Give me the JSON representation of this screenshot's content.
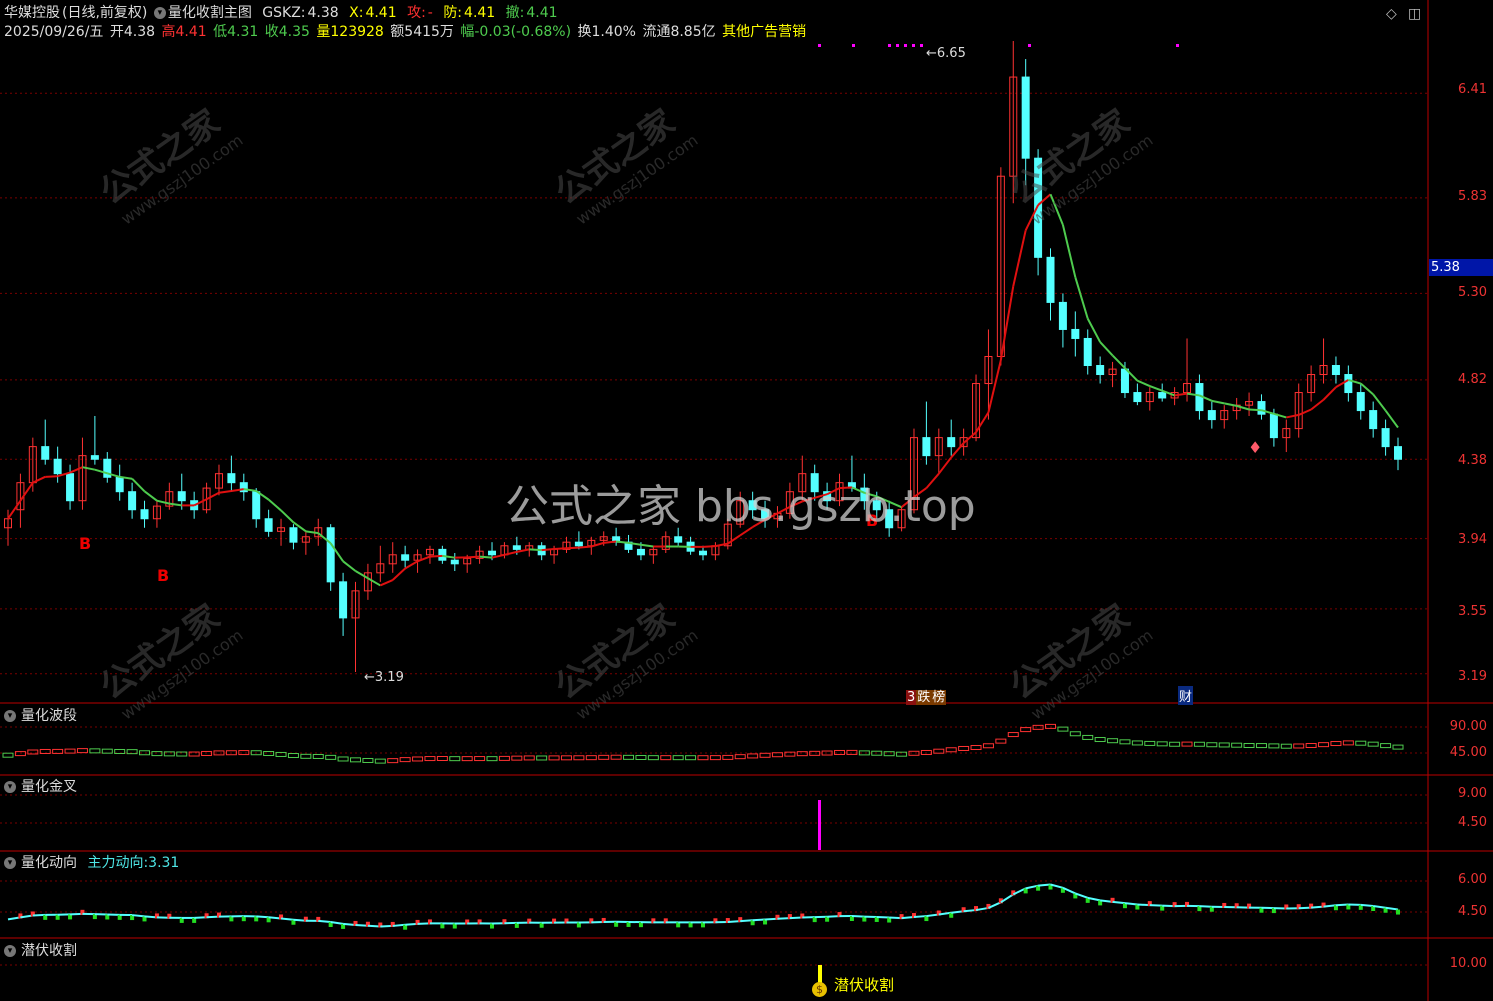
{
  "header": {
    "stock_name": "华媒控股",
    "period_label": "(日线,前复权)",
    "indicator_name": "量化收割主图",
    "gskz_label": "GSKZ:",
    "gskz_value": "4.38",
    "x_label": "X:",
    "x_value": "4.41",
    "gong_label": "攻:",
    "gong_value": "-",
    "fang_label": "防:",
    "fang_value": "4.41",
    "che_label": "撤:",
    "che_value": "4.41"
  },
  "quote": {
    "date": "2025/09/26/五",
    "open": "开4.38",
    "high": "高4.41",
    "low": "低4.31",
    "close": "收4.35",
    "volume": "量123928",
    "amount": "额5415万",
    "change": "幅-0.03(-0.68%)",
    "turnover": "换1.40%",
    "float": "流通8.85亿",
    "sector": "其他广告营销"
  },
  "price_axis": [
    "6.41",
    "5.83",
    "5.30",
    "4.82",
    "4.38",
    "3.94",
    "3.55",
    "3.19"
  ],
  "current_price_tag": "5.38",
  "annotations": {
    "high_mark": "6.65",
    "low_mark": "3.19",
    "buy_marks": [
      "B",
      "B",
      "B"
    ],
    "event_tags": [
      "3",
      "跌",
      "榜",
      "财"
    ]
  },
  "panels": {
    "wave": {
      "title": "量化波段",
      "axis": [
        "90.00",
        "45.00"
      ]
    },
    "golden_cross": {
      "title": "量化金叉",
      "axis": [
        "9.00",
        "4.50"
      ]
    },
    "direction": {
      "title": "量化动向",
      "sub_label": "主力动向:",
      "sub_value": "3.31",
      "axis": [
        "6.00",
        "4.50"
      ]
    },
    "harvest": {
      "title": "潜伏收割",
      "axis": [
        "10.00"
      ],
      "signal_label": "潜伏收割"
    }
  },
  "watermark": {
    "cn": "公式之家",
    "url": "www.gszj100.com",
    "center": "公式之家 bbs.gszb.top"
  },
  "colors": {
    "up": "#ff3232",
    "down": "#54ffff",
    "ma_up": "#e01010",
    "ma_down": "#4ecb4e",
    "grid": "#7a0000",
    "magenta": "#ff00ff",
    "yellow": "#ffff00"
  },
  "chart_data": {
    "type": "candlestick",
    "ylim": [
      3.1,
      6.75
    ],
    "candles": [
      [
        4.0,
        4.1,
        3.9,
        4.05
      ],
      [
        4.1,
        4.3,
        4.0,
        4.25
      ],
      [
        4.25,
        4.5,
        4.2,
        4.45
      ],
      [
        4.45,
        4.6,
        4.35,
        4.38
      ],
      [
        4.38,
        4.45,
        4.25,
        4.3
      ],
      [
        4.3,
        4.35,
        4.1,
        4.15
      ],
      [
        4.15,
        4.5,
        4.1,
        4.4
      ],
      [
        4.4,
        4.62,
        4.35,
        4.38
      ],
      [
        4.38,
        4.42,
        4.25,
        4.28
      ],
      [
        4.28,
        4.35,
        4.15,
        4.2
      ],
      [
        4.2,
        4.25,
        4.05,
        4.1
      ],
      [
        4.1,
        4.15,
        4.0,
        4.05
      ],
      [
        4.05,
        4.15,
        4.0,
        4.12
      ],
      [
        4.12,
        4.25,
        4.1,
        4.2
      ],
      [
        4.2,
        4.3,
        4.1,
        4.15
      ],
      [
        4.15,
        4.2,
        4.05,
        4.1
      ],
      [
        4.1,
        4.25,
        4.08,
        4.22
      ],
      [
        4.22,
        4.35,
        4.18,
        4.3
      ],
      [
        4.3,
        4.4,
        4.2,
        4.25
      ],
      [
        4.25,
        4.3,
        4.15,
        4.2
      ],
      [
        4.2,
        4.22,
        4.0,
        4.05
      ],
      [
        4.05,
        4.1,
        3.95,
        3.98
      ],
      [
        3.98,
        4.05,
        3.9,
        4.0
      ],
      [
        4.0,
        4.02,
        3.88,
        3.92
      ],
      [
        3.92,
        3.98,
        3.85,
        3.95
      ],
      [
        3.95,
        4.05,
        3.9,
        4.0
      ],
      [
        4.0,
        4.02,
        3.65,
        3.7
      ],
      [
        3.7,
        3.75,
        3.4,
        3.5
      ],
      [
        3.5,
        3.7,
        3.2,
        3.65
      ],
      [
        3.65,
        3.8,
        3.6,
        3.75
      ],
      [
        3.75,
        3.9,
        3.7,
        3.8
      ],
      [
        3.8,
        3.92,
        3.75,
        3.85
      ],
      [
        3.85,
        3.9,
        3.78,
        3.82
      ],
      [
        3.82,
        3.88,
        3.75,
        3.85
      ],
      [
        3.85,
        3.9,
        3.8,
        3.88
      ],
      [
        3.88,
        3.9,
        3.8,
        3.82
      ],
      [
        3.82,
        3.86,
        3.76,
        3.8
      ],
      [
        3.8,
        3.85,
        3.75,
        3.83
      ],
      [
        3.83,
        3.9,
        3.8,
        3.87
      ],
      [
        3.87,
        3.92,
        3.82,
        3.85
      ],
      [
        3.85,
        3.92,
        3.83,
        3.9
      ],
      [
        3.9,
        3.95,
        3.85,
        3.88
      ],
      [
        3.88,
        3.92,
        3.84,
        3.9
      ],
      [
        3.9,
        3.92,
        3.82,
        3.85
      ],
      [
        3.85,
        3.9,
        3.8,
        3.88
      ],
      [
        3.88,
        3.95,
        3.86,
        3.92
      ],
      [
        3.92,
        3.98,
        3.88,
        3.9
      ],
      [
        3.9,
        3.95,
        3.85,
        3.93
      ],
      [
        3.93,
        3.98,
        3.9,
        3.95
      ],
      [
        3.95,
        4.0,
        3.9,
        3.92
      ],
      [
        3.92,
        3.96,
        3.86,
        3.88
      ],
      [
        3.88,
        3.92,
        3.82,
        3.85
      ],
      [
        3.85,
        3.9,
        3.8,
        3.88
      ],
      [
        3.88,
        3.98,
        3.86,
        3.95
      ],
      [
        3.95,
        4.0,
        3.9,
        3.92
      ],
      [
        3.92,
        3.95,
        3.85,
        3.87
      ],
      [
        3.87,
        3.9,
        3.82,
        3.85
      ],
      [
        3.85,
        3.92,
        3.82,
        3.9
      ],
      [
        3.9,
        4.05,
        3.88,
        4.02
      ],
      [
        4.02,
        4.2,
        4.0,
        4.15
      ],
      [
        4.15,
        4.2,
        4.05,
        4.1
      ],
      [
        4.1,
        4.15,
        4.0,
        4.05
      ],
      [
        4.05,
        4.12,
        4.0,
        4.08
      ],
      [
        4.08,
        4.25,
        4.05,
        4.2
      ],
      [
        4.2,
        4.4,
        4.15,
        4.3
      ],
      [
        4.3,
        4.35,
        4.15,
        4.2
      ],
      [
        4.2,
        4.25,
        4.1,
        4.15
      ],
      [
        4.15,
        4.3,
        4.12,
        4.25
      ],
      [
        4.25,
        4.4,
        4.2,
        4.22
      ],
      [
        4.22,
        4.3,
        4.1,
        4.15
      ],
      [
        4.15,
        4.2,
        4.05,
        4.1
      ],
      [
        4.1,
        4.15,
        3.95,
        4.0
      ],
      [
        4.0,
        4.12,
        3.98,
        4.1
      ],
      [
        4.1,
        4.55,
        4.08,
        4.5
      ],
      [
        4.5,
        4.7,
        4.35,
        4.4
      ],
      [
        4.4,
        4.55,
        4.3,
        4.5
      ],
      [
        4.5,
        4.6,
        4.4,
        4.45
      ],
      [
        4.45,
        4.55,
        4.4,
        4.5
      ],
      [
        4.5,
        4.85,
        4.48,
        4.8
      ],
      [
        4.8,
        5.1,
        4.6,
        4.95
      ],
      [
        4.95,
        6.0,
        4.9,
        5.95
      ],
      [
        5.95,
        6.7,
        5.8,
        6.5
      ],
      [
        6.5,
        6.6,
        5.9,
        6.05
      ],
      [
        6.05,
        6.1,
        5.4,
        5.5
      ],
      [
        5.5,
        5.55,
        5.15,
        5.25
      ],
      [
        5.25,
        5.3,
        5.0,
        5.1
      ],
      [
        5.1,
        5.2,
        4.95,
        5.05
      ],
      [
        5.05,
        5.1,
        4.85,
        4.9
      ],
      [
        4.9,
        4.95,
        4.8,
        4.85
      ],
      [
        4.85,
        4.92,
        4.78,
        4.88
      ],
      [
        4.88,
        4.92,
        4.72,
        4.75
      ],
      [
        4.75,
        4.8,
        4.68,
        4.7
      ],
      [
        4.7,
        4.78,
        4.65,
        4.75
      ],
      [
        4.75,
        4.8,
        4.7,
        4.72
      ],
      [
        4.72,
        4.78,
        4.68,
        4.75
      ],
      [
        4.75,
        5.05,
        4.7,
        4.8
      ],
      [
        4.8,
        4.85,
        4.6,
        4.65
      ],
      [
        4.65,
        4.7,
        4.55,
        4.6
      ],
      [
        4.6,
        4.68,
        4.55,
        4.65
      ],
      [
        4.65,
        4.72,
        4.6,
        4.68
      ],
      [
        4.68,
        4.75,
        4.62,
        4.7
      ],
      [
        4.7,
        4.74,
        4.6,
        4.63
      ],
      [
        4.63,
        4.66,
        4.45,
        4.5
      ],
      [
        4.5,
        4.6,
        4.42,
        4.55
      ],
      [
        4.55,
        4.8,
        4.5,
        4.75
      ],
      [
        4.75,
        4.9,
        4.7,
        4.85
      ],
      [
        4.85,
        5.05,
        4.8,
        4.9
      ],
      [
        4.9,
        4.95,
        4.8,
        4.85
      ],
      [
        4.85,
        4.9,
        4.7,
        4.75
      ],
      [
        4.75,
        4.8,
        4.6,
        4.65
      ],
      [
        4.65,
        4.7,
        4.5,
        4.55
      ],
      [
        4.55,
        4.6,
        4.4,
        4.45
      ],
      [
        4.45,
        4.5,
        4.32,
        4.38
      ]
    ]
  }
}
